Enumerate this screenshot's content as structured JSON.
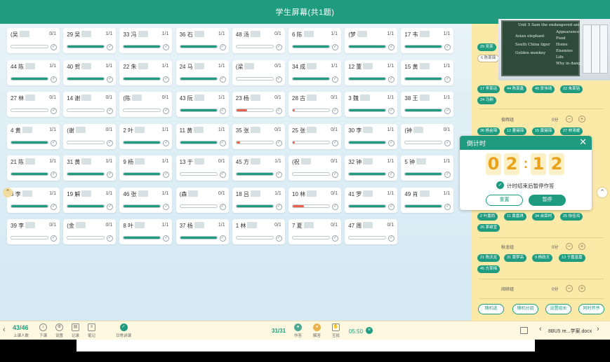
{
  "title": "学生屏幕(共1题)",
  "colors": {
    "accent": "#1f9b7f",
    "warning": "#e8604c",
    "panel": "#fbe9a8"
  },
  "students": [
    {
      "id": "s1",
      "label": "(吴",
      "score": "0/1",
      "progress": 0,
      "status": "none"
    },
    {
      "id": "s2",
      "label": "29 吴",
      "score": "1/1",
      "progress": 1,
      "status": "done"
    },
    {
      "id": "s3",
      "label": "33 冯",
      "score": "1/1",
      "progress": 1,
      "status": "done"
    },
    {
      "id": "s4",
      "label": "36 石",
      "score": "1/1",
      "progress": 1,
      "status": "done"
    },
    {
      "id": "s5",
      "label": "48 汤",
      "score": "0/1",
      "progress": 0,
      "status": "none"
    },
    {
      "id": "s6",
      "label": "6 陈",
      "score": "1/1",
      "progress": 1,
      "status": "done"
    },
    {
      "id": "s7",
      "label": "(梦",
      "score": "1/1",
      "progress": 1,
      "status": "done"
    },
    {
      "id": "s8",
      "label": "17 韦",
      "score": "1/1",
      "progress": 1,
      "status": "done"
    },
    {
      "id": "s9",
      "label": "44 陈",
      "score": "1/1",
      "progress": 1,
      "status": "done"
    },
    {
      "id": "s10",
      "label": "40 贺",
      "score": "1/1",
      "progress": 1,
      "status": "done"
    },
    {
      "id": "s11",
      "label": "22 朱",
      "score": "1/1",
      "progress": 1,
      "status": "done"
    },
    {
      "id": "s12",
      "label": "24 马",
      "score": "1/1",
      "progress": 1,
      "status": "done"
    },
    {
      "id": "s13",
      "label": "(梁",
      "score": "0/1",
      "progress": 0,
      "status": "none"
    },
    {
      "id": "s14",
      "label": "34 成",
      "score": "1/1",
      "progress": 1,
      "status": "done"
    },
    {
      "id": "s15",
      "label": "12 董",
      "score": "1/1",
      "progress": 1,
      "status": "done"
    },
    {
      "id": "s16",
      "label": "15 黄",
      "score": "1/1",
      "progress": 1,
      "status": "done"
    },
    {
      "id": "s17",
      "label": "27 林",
      "score": "0/1",
      "progress": 0,
      "status": "none"
    },
    {
      "id": "s18",
      "label": "14 谢",
      "score": "0/1",
      "progress": 0,
      "status": "none"
    },
    {
      "id": "s19",
      "label": "(陈",
      "score": "0/1",
      "progress": 0,
      "status": "none"
    },
    {
      "id": "s20",
      "label": "43 阮",
      "score": "1/1",
      "progress": 1,
      "status": "done"
    },
    {
      "id": "s21",
      "label": "23 杨",
      "score": "0/1",
      "progress": 0.3,
      "status": "wrong"
    },
    {
      "id": "s22",
      "label": "28 古",
      "score": "0/1",
      "progress": 0.05,
      "status": "wrong"
    },
    {
      "id": "s23",
      "label": "3 魏",
      "score": "1/1",
      "progress": 1,
      "status": "done"
    },
    {
      "id": "s24",
      "label": "38 王",
      "score": "1/1",
      "progress": 1,
      "status": "done"
    },
    {
      "id": "s25",
      "label": "4 黄",
      "score": "1/1",
      "progress": 1,
      "status": "done"
    },
    {
      "id": "s26",
      "label": "(谢",
      "score": "0/1",
      "progress": 0,
      "status": "none"
    },
    {
      "id": "s27",
      "label": "2 叶",
      "score": "1/1",
      "progress": 1,
      "status": "done"
    },
    {
      "id": "s28",
      "label": "11 黄",
      "score": "1/1",
      "progress": 1,
      "status": "done"
    },
    {
      "id": "s29",
      "label": "35 张",
      "score": "0/1",
      "progress": 0.1,
      "status": "wrong"
    },
    {
      "id": "s30",
      "label": "25 张",
      "score": "0/1",
      "progress": 0.05,
      "status": "wrong"
    },
    {
      "id": "s31",
      "label": "30 李",
      "score": "1/1",
      "progress": 1,
      "status": "done"
    },
    {
      "id": "s32",
      "label": "(钟",
      "score": "0/1",
      "progress": 0,
      "status": "none"
    },
    {
      "id": "s33",
      "label": "21 陈",
      "score": "1/1",
      "progress": 1,
      "status": "done"
    },
    {
      "id": "s34",
      "label": "31 黄",
      "score": "1/1",
      "progress": 1,
      "status": "done"
    },
    {
      "id": "s35",
      "label": "9 杨",
      "score": "1/1",
      "progress": 1,
      "status": "done"
    },
    {
      "id": "s36",
      "label": "13 于",
      "score": "0/1",
      "progress": 0,
      "status": "none"
    },
    {
      "id": "s37",
      "label": "45 方",
      "score": "1/1",
      "progress": 1,
      "status": "done"
    },
    {
      "id": "s38",
      "label": "(祝",
      "score": "0/1",
      "progress": 0,
      "status": "none"
    },
    {
      "id": "s39",
      "label": "32 钟",
      "score": "1/1",
      "progress": 1,
      "status": "done"
    },
    {
      "id": "s40",
      "label": "5 钟",
      "score": "1/1",
      "progress": 1,
      "status": "done"
    },
    {
      "id": "s41",
      "label": "6 李",
      "score": "1/1",
      "progress": 1,
      "status": "done"
    },
    {
      "id": "s42",
      "label": "19 解",
      "score": "1/1",
      "progress": 1,
      "status": "done"
    },
    {
      "id": "s43",
      "label": "46 张",
      "score": "1/1",
      "progress": 1,
      "status": "done"
    },
    {
      "id": "s44",
      "label": "(森",
      "score": "0/1",
      "progress": 0,
      "status": "none"
    },
    {
      "id": "s45",
      "label": "18 吕",
      "score": "1/1",
      "progress": 1,
      "status": "done"
    },
    {
      "id": "s46",
      "label": "10 林",
      "score": "0/1",
      "progress": 0.3,
      "status": "wrong"
    },
    {
      "id": "s47",
      "label": "41 罗",
      "score": "1/1",
      "progress": 1,
      "status": "done"
    },
    {
      "id": "s48",
      "label": "49 肖",
      "score": "1/1",
      "progress": 1,
      "status": "done"
    },
    {
      "id": "s49",
      "label": "39 李",
      "score": "0/1",
      "progress": 0,
      "status": "none"
    },
    {
      "id": "s50",
      "label": "(金",
      "score": "0/1",
      "progress": 0,
      "status": "none"
    },
    {
      "id": "s51",
      "label": "8 叶",
      "score": "1/1",
      "progress": 1,
      "status": "done"
    },
    {
      "id": "s52",
      "label": "37 杨",
      "score": "1/1",
      "progress": 1,
      "status": "done"
    },
    {
      "id": "s53",
      "label": "1 林",
      "score": "0/1",
      "progress": 0,
      "status": "none"
    },
    {
      "id": "s54",
      "label": "7 夏",
      "score": "0/1",
      "progress": 0,
      "status": "none"
    },
    {
      "id": "s55",
      "label": "47 周",
      "score": "0/1",
      "progress": 0,
      "status": "none"
    }
  ],
  "video": {
    "board_lines": [
      "Unit 5 Sam the endangered animal",
      "Asian elephant",
      "South China tiger",
      "Golden monkey",
      "Appearance",
      "Food",
      "Home",
      "Enemies",
      "Life",
      "Why in danger"
    ]
  },
  "groups": [
    {
      "chips_top": [
        "29 吴某",
        "6 陈某锦"
      ]
    },
    {
      "chips": [
        "17 李某运",
        "44 陈某鑫",
        "40 贺伟琦",
        "22 朱某铭",
        "24 马俐"
      ]
    },
    {
      "name": "俊辉组",
      "score": "0分",
      "chips": [
        "36 杨金锦",
        "12 董锡锦",
        "15 黄锡锦",
        "27 林清媛"
      ]
    },
    {
      "chips_bottom": [
        "2 叶嘉而",
        "11 黄嘉琪",
        "34 余荣柯",
        "25 徐佳鸿",
        "26 茅颖宜"
      ]
    },
    {
      "name": "秋龙组",
      "score": "0分",
      "chips": [
        "21 陈沃龙",
        "31 黄梦高",
        "9 杨政文",
        "13 于嘉富嘉",
        "45 方某梅"
      ]
    },
    {
      "name": "阅研组",
      "score": "0分"
    }
  ],
  "panel_buttons": [
    "随机选",
    "随机分组",
    "设置组长",
    "同时开序"
  ],
  "timer": {
    "title": "倒计时",
    "digits": [
      "0",
      "2",
      "1",
      "2"
    ],
    "colon": ":",
    "option": "计时结束后暂停作答",
    "reset": "重置",
    "pause": "暂停"
  },
  "toolbar": {
    "count": "43/46",
    "count_label": "上课人数",
    "items": [
      "下课",
      "设置",
      "记录",
      "笔记"
    ],
    "quiz_label": "日常讲课",
    "progress": "31/31",
    "items2": [
      "作答",
      "解答",
      "互批"
    ],
    "time": "05:50",
    "doc": "8BU5 re...学案.docx"
  }
}
